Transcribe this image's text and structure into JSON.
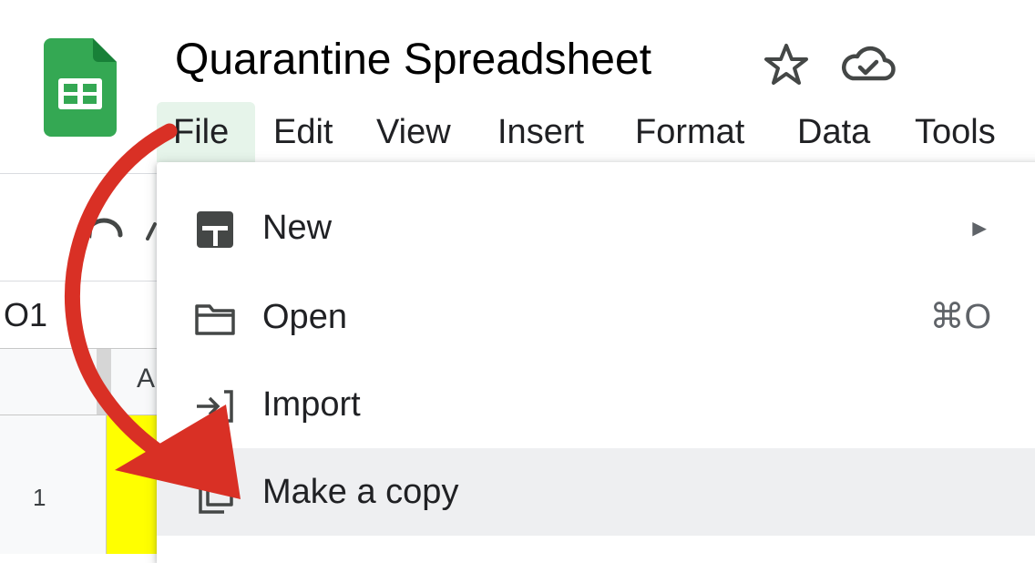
{
  "document": {
    "title": "Quarantine Spreadsheet"
  },
  "icons": {
    "logo": "google-sheets-logo",
    "star": "star-icon",
    "cloud": "cloud-saved-icon",
    "undo": "undo-icon"
  },
  "menu_bar": [
    {
      "label": "File",
      "active": true
    },
    {
      "label": "Edit"
    },
    {
      "label": "View"
    },
    {
      "label": "Insert"
    },
    {
      "label": "Format"
    },
    {
      "label": "Data"
    },
    {
      "label": "Tools"
    }
  ],
  "grid": {
    "name_box": "O1",
    "column_header": "A",
    "row_number": "1",
    "highlight_color": "#ffff00"
  },
  "file_menu": [
    {
      "label": "New",
      "icon": "new-sheet-icon",
      "right": "►"
    },
    {
      "label": "Open",
      "icon": "folder-icon",
      "right": "⌘O"
    },
    {
      "label": "Import",
      "icon": "import-icon",
      "right": ""
    },
    {
      "label": "Make a copy",
      "icon": "copy-icon",
      "right": "",
      "highlighted": true
    }
  ],
  "colors": {
    "brand_green": "#34a853",
    "annotation_red": "#d93025",
    "active_menu_bg": "#e6f4ea",
    "hover_bg": "#eeeff1"
  }
}
